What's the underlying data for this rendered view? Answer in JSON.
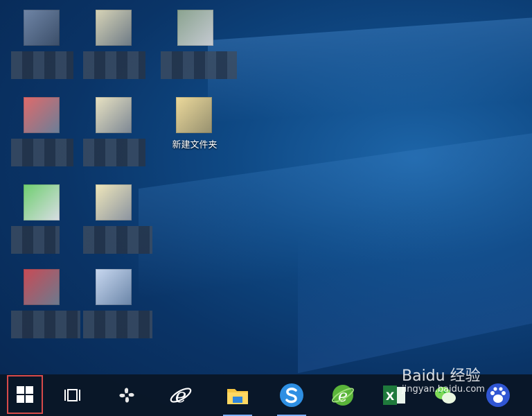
{
  "desktop": {
    "icons": [
      {
        "label": ""
      },
      {
        "label": ""
      },
      {
        "label": ""
      },
      {
        "label": ""
      },
      {
        "label": ""
      },
      {
        "label": "新建文件夹"
      },
      {
        "label": ""
      },
      {
        "label": ""
      },
      {
        "label": ""
      },
      {
        "label": ""
      }
    ]
  },
  "taskbar": {
    "items": [
      {
        "icon": "windows-start-icon"
      },
      {
        "icon": "task-view-icon"
      },
      {
        "icon": "pinwheel-app-icon"
      },
      {
        "icon": "internet-explorer-icon"
      },
      {
        "icon": "file-explorer-icon"
      },
      {
        "icon": "sogou-search-icon"
      },
      {
        "icon": "green-browser-icon"
      },
      {
        "icon": "excel-icon"
      },
      {
        "icon": "wechat-icon"
      },
      {
        "icon": "baidu-paw-icon"
      }
    ]
  },
  "watermark": {
    "top": "Baidu 经验",
    "bottom": "jingyan.baidu.com"
  },
  "colors": {
    "start_highlight": "#d84a4a",
    "taskbar_bg": "#0a1626",
    "desktop_bg": "#0a3467"
  }
}
